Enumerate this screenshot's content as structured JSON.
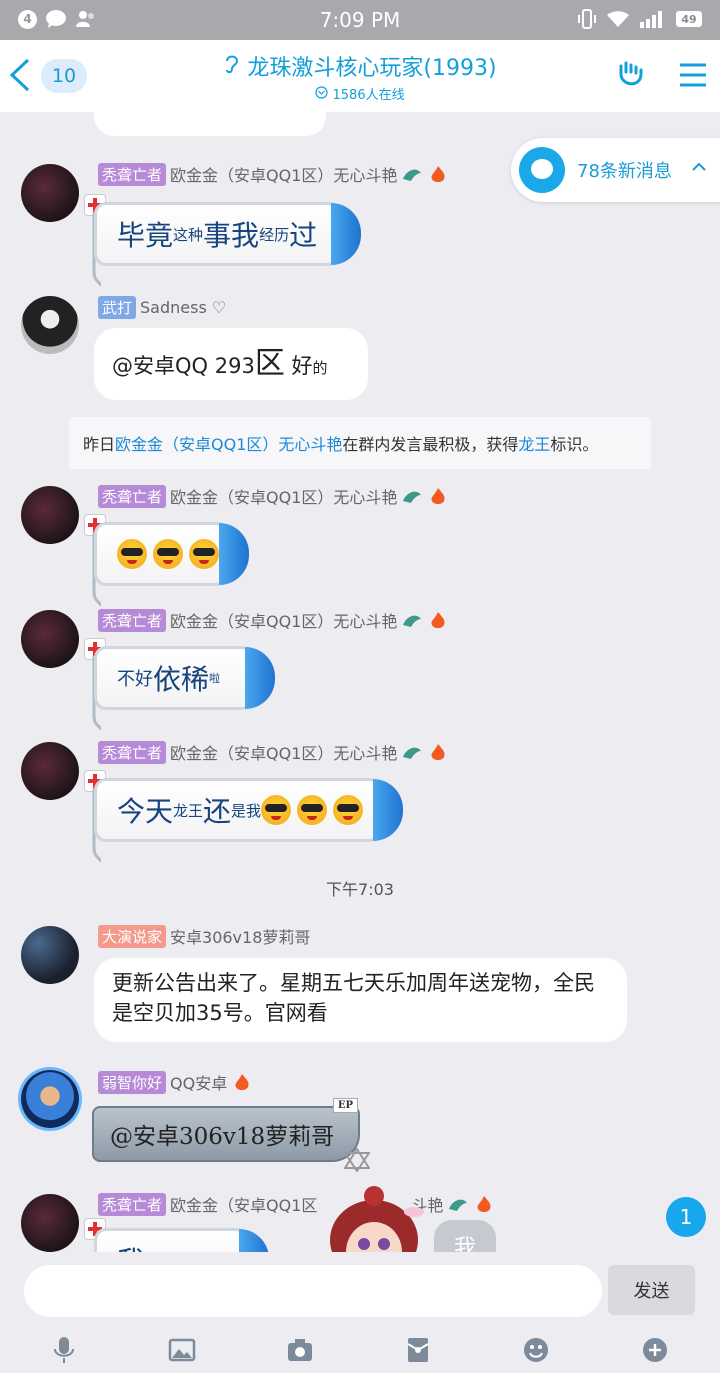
{
  "status_bar": {
    "notification_count": "4",
    "time": "7:09 PM",
    "battery": "49"
  },
  "header": {
    "unread_count": "10",
    "group_title": "龙珠激斗核心玩家(1993)",
    "online_text": "1586人在线"
  },
  "new_messages_banner": "78条新消息",
  "messages": [
    {
      "tag": "秃聋亡者",
      "name": "欧金金（安卓QQ1区）无心斗艳",
      "big1": "毕竟",
      "small1": "这种",
      "big2": "事",
      "big3": "我",
      "small2": "经历",
      "big4": "过"
    },
    {
      "tag": "武打",
      "name": "Sadness ♡",
      "text_a": "@安卓QQ 293",
      "text_b": "区",
      "text_c": "好",
      "text_d": "的"
    },
    {
      "tag": "秃聋亡者",
      "name": "欧金金（安卓QQ1区）无心斗艳"
    },
    {
      "tag": "秃聋亡者",
      "name": "欧金金（安卓QQ1区）无心斗艳",
      "small1": "不好",
      "big1": "依稀",
      "small2": "啦"
    },
    {
      "tag": "秃聋亡者",
      "name": "欧金金（安卓QQ1区）无心斗艳",
      "big1": "今天",
      "small1": "龙王",
      "big2": "还",
      "small2": "是我"
    },
    {
      "tag": "大演说家",
      "name": "安卓306v18萝莉哥",
      "text": "更新公告出来了。星期五七天乐加周年送宠物，全民是空贝加35号。官网看"
    },
    {
      "tag": "弱智你好",
      "name": "QQ安卓",
      "text": "@安卓306v18萝莉哥",
      "badge": "EP"
    },
    {
      "tag": "秃聋亡者",
      "name": "欧金金（安卓QQ1区",
      "name_tail": "斗艳",
      "text": "我"
    }
  ],
  "system_notice": {
    "prefix": "昨日",
    "user": "欧金金（安卓QQ1区）无心斗艳",
    "middle": "在群内发言最积极，获得",
    "title": "龙王",
    "suffix": "标识。"
  },
  "timestamp": "下午7:03",
  "unread_badge": "1",
  "me_bubble": "我",
  "input": {
    "value": "",
    "send_label": "发送"
  },
  "colors": {
    "accent": "#12a0db",
    "tag_purple": "#b68ad6",
    "tag_blue": "#7ea9e6",
    "tag_salmon": "#f39a8c"
  },
  "toolbar_icons": [
    "microphone-icon",
    "image-icon",
    "camera-icon",
    "red-packet-icon",
    "emoji-icon",
    "plus-icon"
  ]
}
